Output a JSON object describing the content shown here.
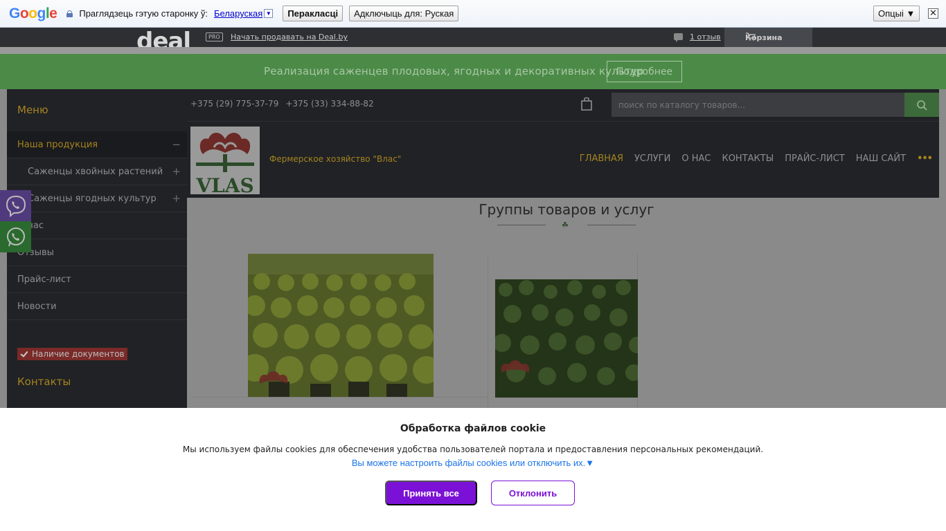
{
  "translate_bar": {
    "logo": [
      "G",
      "o",
      "o",
      "g",
      "l",
      "e"
    ],
    "prompt": "Прагляд­зець гэтую старонку ў:",
    "language": "Беларуская",
    "language_dropdown": "▼",
    "translate_button": "Перакласці",
    "disable_button": "Адключыць для: Руская",
    "options_button": "Опцыі ▼",
    "close": "✕"
  },
  "deal_bar": {
    "logo": "deal",
    "pro_badge": "PRO",
    "sell_link": "Начать продавать на Deal.by",
    "reviews_link": "1 отзыв",
    "cart_label": "Корзина"
  },
  "banner": {
    "text": "Реализация саженцев плодовых, ягодных и декоративных культур",
    "button": "Подробнее"
  },
  "sidebar": {
    "title": "Меню",
    "items": [
      {
        "label": "Наша продукция",
        "toggle": "−"
      },
      {
        "label": "Саженцы хвойных растений",
        "toggle": "+"
      },
      {
        "label": "Саженцы ягодных культур",
        "toggle": "+"
      },
      {
        "label": "О нас",
        "toggle": ""
      },
      {
        "label": "Отзывы",
        "toggle": ""
      },
      {
        "label": "Прайс-лист",
        "toggle": ""
      },
      {
        "label": "Новости",
        "toggle": ""
      }
    ],
    "docs_badge": "Наличие документов",
    "contacts": "Контакты"
  },
  "header": {
    "phone1": "+375 (29) 775-37-79",
    "phone2": "+375 (33) 334-88-82",
    "search_placeholder": "поиск по каталогу товаров...",
    "company": "Фермерское хозяйство \"Влас\"",
    "logo_text": "VLAS",
    "nav": [
      "ГЛАВНАЯ",
      "УСЛУГИ",
      "О НАС",
      "КОНТАКТЫ",
      "ПРАЙС-ЛИСТ",
      "НАШ САЙТ"
    ],
    "nav_more": "•••"
  },
  "content": {
    "title": "Группы товаров и услуг"
  },
  "cookie": {
    "title": "Обработка файлов cookie",
    "text": "Мы используем файлы cookies для обеспечения удобства пользователей портала и предоставления персональных рекомендаций.",
    "link": "Вы можете настроить файлы cookies или отключить их.▼",
    "accept": "Принять все",
    "decline": "Отклонить"
  },
  "colors": {
    "accent_gold": "#a6841e",
    "banner_green": "#4c8a48",
    "cookie_purple": "#7b11d6",
    "link_blue": "#1a73e8"
  }
}
